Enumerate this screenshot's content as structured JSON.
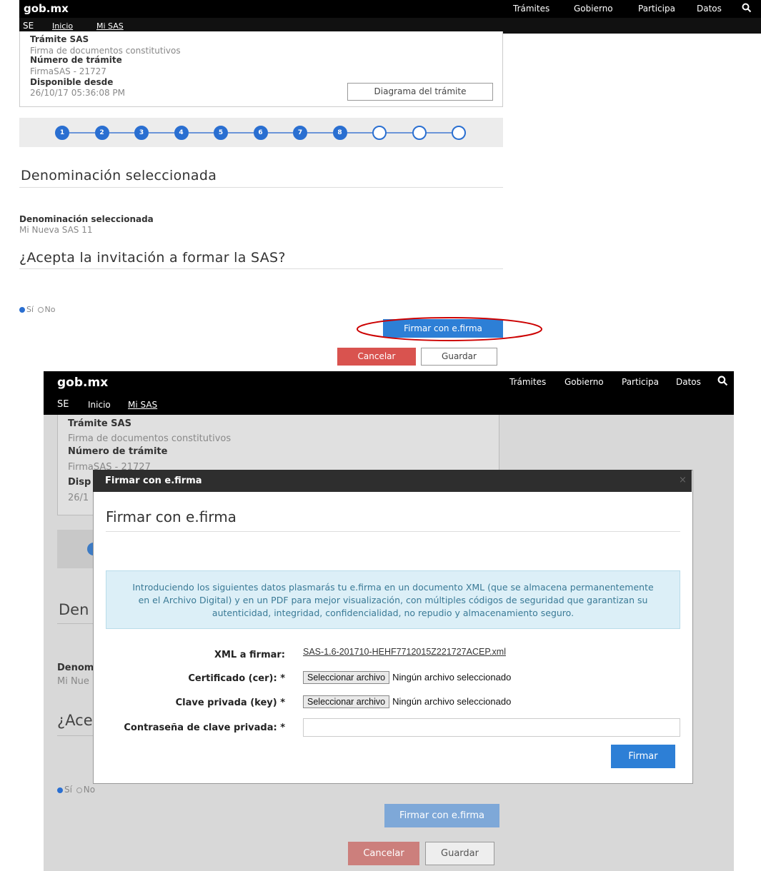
{
  "header": {
    "logo": "gob.mx",
    "nav": [
      "Trámites",
      "Gobierno",
      "Participa",
      "Datos"
    ],
    "search_icon": "search-icon"
  },
  "subnav": {
    "brand": "SE",
    "links": [
      "Inicio",
      "Mi SAS"
    ]
  },
  "summary": {
    "tramite_label": "Trámite SAS",
    "tramite_value": "Firma de documentos constitutivos",
    "numero_label": "Número de trámite",
    "numero_value": "FirmaSAS - 21727",
    "disponible_label": "Disponible desde",
    "disponible_value": "26/10/17 05:36:08 PM",
    "diagram_button": "Diagrama del trámite"
  },
  "steps": {
    "labels": [
      "1",
      "2",
      "3",
      "4",
      "5",
      "6",
      "7",
      "8"
    ],
    "total": 11,
    "completed": 8
  },
  "section1": {
    "heading": "Denominación seleccionada",
    "field_label": "Denominación seleccionada",
    "field_value": "Mi Nueva SAS 11"
  },
  "section2": {
    "heading": "¿Acepta la invitación a formar la SAS?",
    "options": [
      "Sí",
      "No"
    ],
    "selected": "Sí"
  },
  "buttons": {
    "firmar": "Firmar con e.firma",
    "cancelar": "Cancelar",
    "guardar": "Guardar"
  },
  "modal": {
    "header_title": "Firmar con e.firma",
    "close_symbol": "×",
    "title": "Firmar con e.firma",
    "info_line1": "Introduciendo los siguientes datos plasmarás tu e.firma en un documento XML (que se almacena permanentemente",
    "info_line2": "en el Archivo Digital) y en un PDF para mejor visualización, con múltiples códigos de seguridad que garantizan su",
    "info_line3": "autenticidad, integridad, confidencialidad, no repudio y almacenamiento seguro.",
    "xml_label": "XML a firmar:",
    "xml_file": "SAS-1.6-201710-HEHF7712015Z221727ACEP.xml",
    "cer_label": "Certificado (cer): *",
    "key_label": "Clave privada (key) *",
    "file_button": "Seleccionar archivo",
    "file_none": "Ningún archivo seleccionado",
    "password_label": "Contraseña de clave privada: *",
    "password_value": "",
    "submit": "Firmar"
  },
  "bg_partial": {
    "step1": "Den",
    "field": "Denom",
    "value": "Mi Nue",
    "heading": "¿Ace",
    "disp": "Disp",
    "date": "26/1"
  },
  "colors": {
    "primary": "#2d7fd6",
    "danger": "#d9534f",
    "highlight": "#cc0000",
    "alert_bg": "#dceff7"
  }
}
